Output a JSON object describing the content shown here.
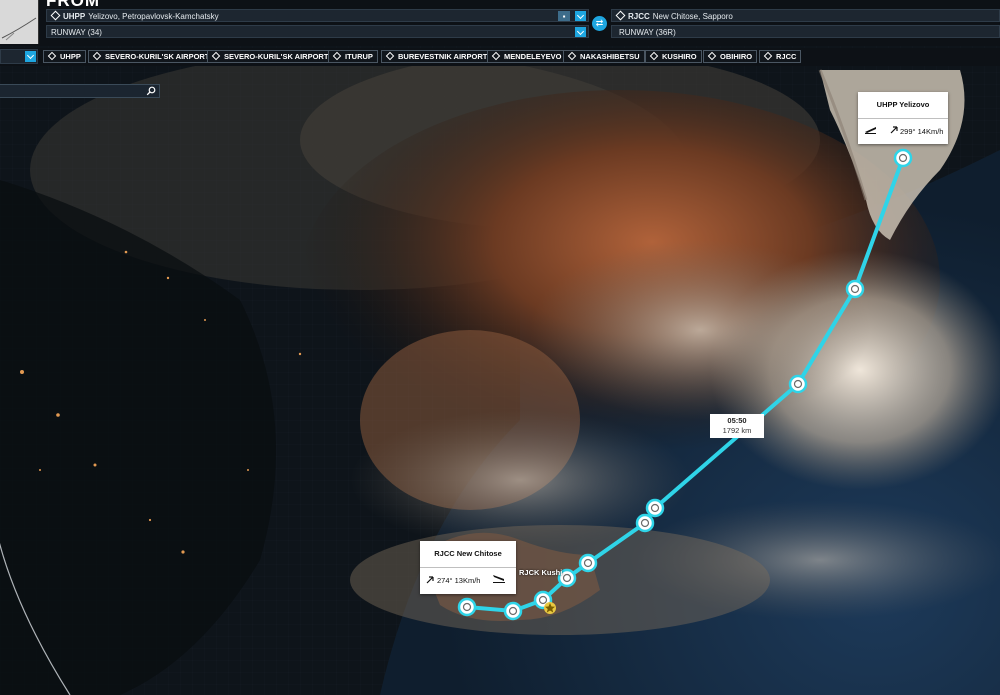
{
  "header": {
    "title": "FROM"
  },
  "departure": {
    "code": "UHPP",
    "name": "Yelizovo, Petropavlovsk-Kamchatsky",
    "runway": "RUNWAY (34)"
  },
  "arrival": {
    "code": "RJCC",
    "name": "New Chitose, Sapporo",
    "runway": "RUNWAY (36R)"
  },
  "waypoints": [
    "UHPP",
    "SEVERO-KURIL'SK AIRPORT",
    "SEVERO-KURIL'SK AIRPORT",
    "ITURUP",
    "BUREVESTNIK AIRPORT",
    "MENDELEYEVO",
    "NAKASHIBETSU",
    "KUSHIRO",
    "OBIHIRO",
    "RJCC"
  ],
  "search": {
    "placeholder": ""
  },
  "cards": {
    "departure": {
      "title": "UHPP  Yelizovo",
      "wind": "299° 14Km/h"
    },
    "arrival": {
      "title": "RJCC  New Chitose",
      "wind": "274° 13Km/h"
    }
  },
  "route_info": {
    "time": "05:50",
    "distance": "1792 km"
  },
  "map_labels": {
    "kushiro": "RJCK  Kushi"
  },
  "colors": {
    "route": "#2fd4e8",
    "accent": "#1ea6e0",
    "topbar": "#0d1116"
  }
}
